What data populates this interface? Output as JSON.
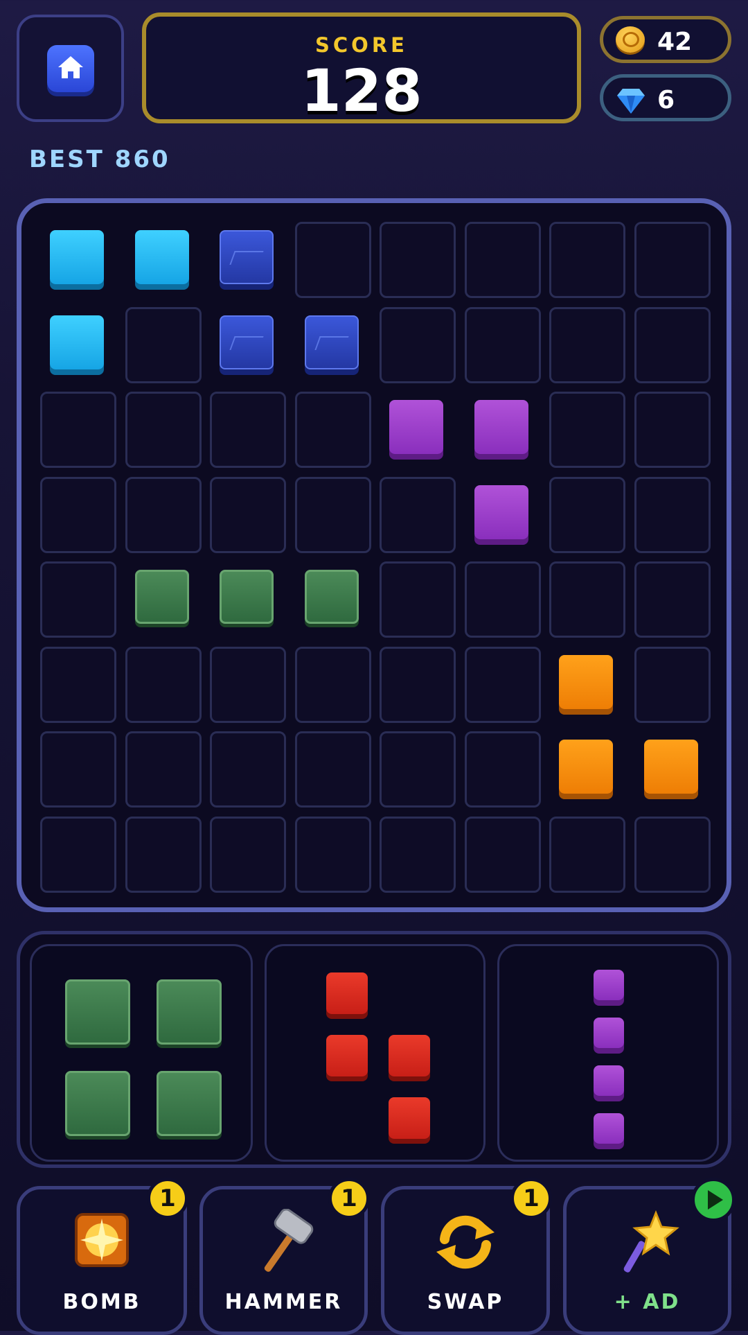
{
  "header": {
    "score_label": "SCORE",
    "score_value": "128",
    "coins": "42",
    "gems": "6",
    "best_label": "BEST 860"
  },
  "board": {
    "rows": 8,
    "cols": 8,
    "blocks": [
      {
        "row": 0,
        "col": 0,
        "color": "cyan"
      },
      {
        "row": 0,
        "col": 1,
        "color": "cyan"
      },
      {
        "row": 0,
        "col": 2,
        "color": "cobalt"
      },
      {
        "row": 1,
        "col": 0,
        "color": "cyan"
      },
      {
        "row": 1,
        "col": 2,
        "color": "cobalt"
      },
      {
        "row": 1,
        "col": 3,
        "color": "cobalt"
      },
      {
        "row": 2,
        "col": 4,
        "color": "purple"
      },
      {
        "row": 2,
        "col": 5,
        "color": "purple"
      },
      {
        "row": 3,
        "col": 5,
        "color": "purple"
      },
      {
        "row": 4,
        "col": 1,
        "color": "green"
      },
      {
        "row": 4,
        "col": 2,
        "color": "green"
      },
      {
        "row": 4,
        "col": 3,
        "color": "green"
      },
      {
        "row": 5,
        "col": 6,
        "color": "orange"
      },
      {
        "row": 6,
        "col": 6,
        "color": "orange"
      },
      {
        "row": 6,
        "col": 7,
        "color": "orange"
      }
    ]
  },
  "tray": [
    {
      "name": "green-square-piece",
      "color": "green",
      "cells": [
        [
          0,
          0
        ],
        [
          0,
          1
        ],
        [
          1,
          0
        ],
        [
          1,
          1
        ]
      ]
    },
    {
      "name": "red-s-piece",
      "color": "red",
      "cells": [
        [
          0,
          0
        ],
        [
          1,
          0
        ],
        [
          1,
          1
        ],
        [
          2,
          1
        ]
      ]
    },
    {
      "name": "purple-line-piece",
      "color": "purple",
      "cells": [
        [
          0,
          0
        ],
        [
          1,
          0
        ],
        [
          2,
          0
        ],
        [
          3,
          0
        ]
      ]
    }
  ],
  "powerups": [
    {
      "label": "BOMB",
      "badge": "1",
      "icon": "bomb-icon"
    },
    {
      "label": "HAMMER",
      "badge": "1",
      "icon": "hammer-icon"
    },
    {
      "label": "SWAP",
      "badge": "1",
      "icon": "swap-icon"
    },
    {
      "label": "+ AD",
      "badge": "play",
      "icon": "magic-wand-icon"
    }
  ],
  "colors": {
    "cyan": "#22b6f0",
    "cobalt": "#2d44b8",
    "purple": "#9a3cc8",
    "green": "#3f7a4b",
    "orange": "#f58c0c",
    "red": "#d8281d",
    "gold_accent": "#f3c72c",
    "ad_green": "#7fe08a"
  }
}
